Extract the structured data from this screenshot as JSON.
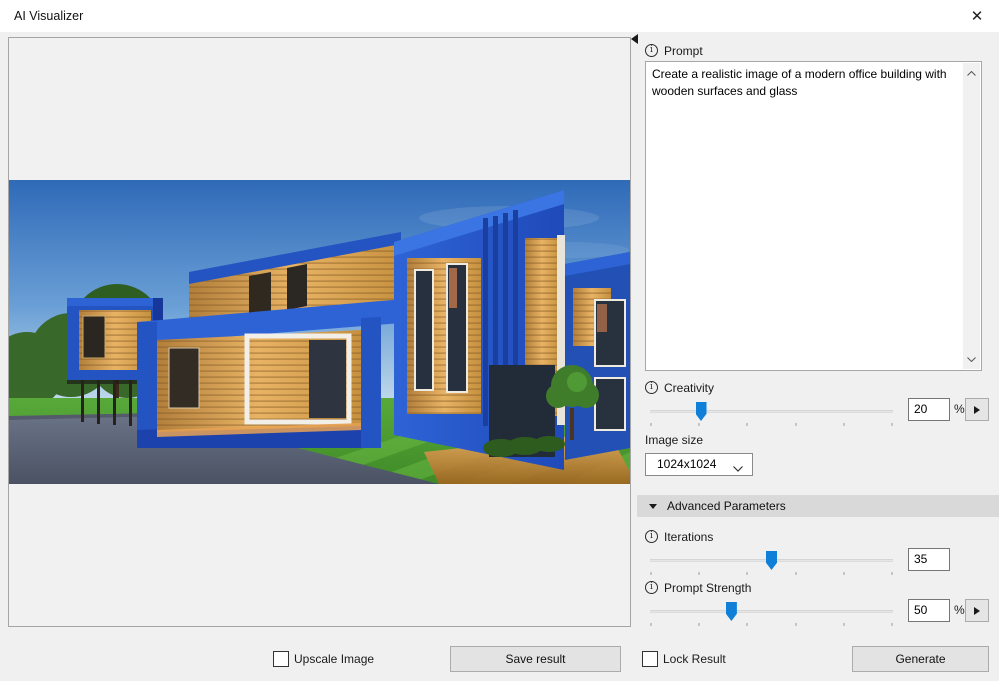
{
  "window": {
    "title": "AI Visualizer"
  },
  "preview": {
    "description": "Rendered result: modern blue office building with wooden slat surfaces and glass windows, green lawn, dark driveway, trees and blue sky"
  },
  "panel": {
    "prompt": {
      "label": "Prompt",
      "value": "Create a realistic image of a modern office building with wooden surfaces and glass"
    },
    "creativity": {
      "label": "Creativity",
      "value": "20",
      "unit": "%",
      "percent": 21
    },
    "image_size": {
      "label": "Image size",
      "selected": "1024x1024"
    },
    "advanced": {
      "label": "Advanced Parameters",
      "iterations": {
        "label": "Iterations",
        "value": "35",
        "percent": 50
      },
      "prompt_strength": {
        "label": "Prompt Strength",
        "value": "50",
        "unit": "%",
        "percent": 33.5
      }
    },
    "lock_result": {
      "label": "Lock Result",
      "checked": false
    },
    "generate": {
      "label": "Generate"
    }
  },
  "footer": {
    "upscale": {
      "label": "Upscale Image",
      "checked": false
    },
    "save": {
      "label": "Save result"
    }
  },
  "colors": {
    "accent": "#0f7fd7",
    "section_header": "#d9d9d9",
    "button_face": "#e3e3e3"
  }
}
